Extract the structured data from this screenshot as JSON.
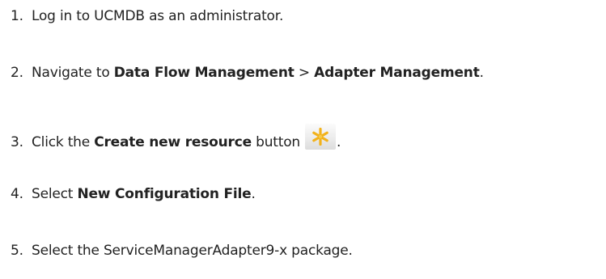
{
  "steps": [
    {
      "number": "1.",
      "text": "Log in to UCMDB as an administrator."
    },
    {
      "number": "2.",
      "prefix": "Navigate to ",
      "bold1": "Data Flow Management",
      "separator": " > ",
      "bold2": "Adapter Management",
      "suffix": "."
    },
    {
      "number": "3.",
      "prefix": "Click the ",
      "bold": "Create new resource",
      "middle": " button",
      "icon": "asterisk-new-icon",
      "suffix": "."
    },
    {
      "number": "4.",
      "prefix": "Select ",
      "bold": "New Configuration File",
      "suffix": "."
    },
    {
      "number": "5.",
      "text": "Select the ServiceManagerAdapter9-x package."
    }
  ],
  "colors": {
    "text": "#222222",
    "icon_asterisk": "#f2b21b",
    "icon_background": "#e9e9e9"
  }
}
